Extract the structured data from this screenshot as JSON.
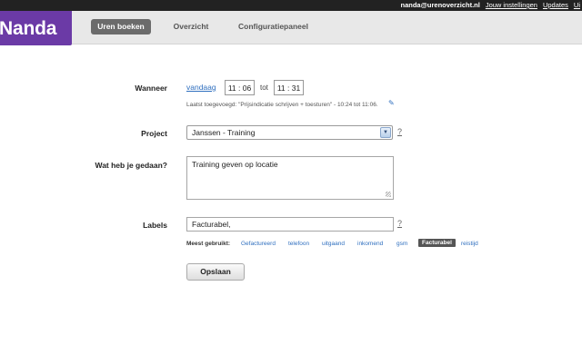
{
  "topbar": {
    "email": "nanda@urenoverzicht.nl",
    "links": [
      "Jouw instellingen",
      "Updates",
      "Ui"
    ]
  },
  "logo": {
    "text": "Nanda"
  },
  "nav": {
    "tabs": [
      {
        "label": "Uren boeken",
        "active": true
      },
      {
        "label": "Overzicht",
        "active": false
      },
      {
        "label": "Configuratiepaneel",
        "active": false
      }
    ]
  },
  "form": {
    "wanneer": {
      "label": "Wanneer",
      "date_link": "vandaag",
      "start_time": "11 : 06",
      "separator": "tot",
      "end_time": "11 : 31",
      "last_added": "Laatst toegevoegd: \"Prijsindicatie schrijven + toesturen\" - 10:24 tot 11:06."
    },
    "project": {
      "label": "Project",
      "selected": "Janssen - Training",
      "help": "?"
    },
    "gedaan": {
      "label": "Wat heb je gedaan?",
      "value": "Training geven op locatie"
    },
    "labels": {
      "label": "Labels",
      "value": "Facturabel,",
      "help": "?",
      "most_used_label": "Meest gebruikt:",
      "tags": [
        {
          "text": "Gefactureerd",
          "selected": false
        },
        {
          "text": "telefoon",
          "selected": false
        },
        {
          "text": "uitgaand",
          "selected": false
        },
        {
          "text": "inkomend",
          "selected": false
        },
        {
          "text": "gsm",
          "selected": false
        },
        {
          "text": "Facturabel",
          "selected": true
        },
        {
          "text": "reistijd",
          "selected": false
        }
      ]
    },
    "submit_label": "Opslaan"
  },
  "colors": {
    "brand": "#6b3aa6",
    "active_tab": "#6b6b6b",
    "link": "#2f6fbf"
  }
}
